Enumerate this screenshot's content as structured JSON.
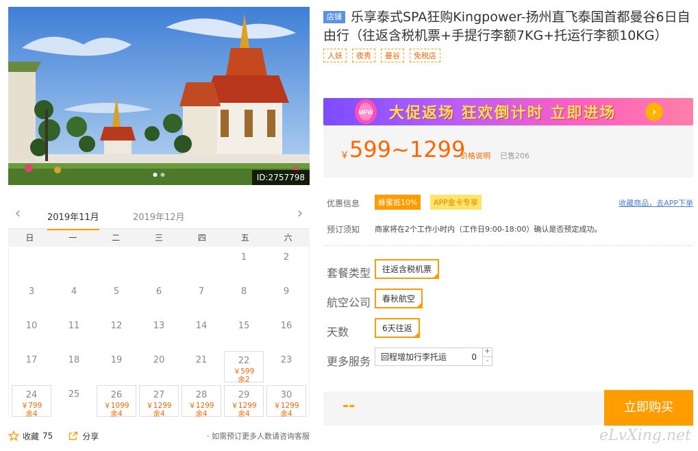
{
  "hero": {
    "image_id": "ID:2757798",
    "dots": 2,
    "active_dot": 0
  },
  "calendar": {
    "month_active": "2019年11月",
    "month_next": "2019年12月",
    "weekdays": [
      "日",
      "一",
      "二",
      "三",
      "四",
      "五",
      "六"
    ],
    "days": [
      {
        "d": ""
      },
      {
        "d": ""
      },
      {
        "d": ""
      },
      {
        "d": ""
      },
      {
        "d": ""
      },
      {
        "d": "1"
      },
      {
        "d": "2"
      },
      {
        "d": "3"
      },
      {
        "d": "4"
      },
      {
        "d": "5"
      },
      {
        "d": "6"
      },
      {
        "d": "7"
      },
      {
        "d": "8"
      },
      {
        "d": "9"
      },
      {
        "d": "10"
      },
      {
        "d": "11"
      },
      {
        "d": "12"
      },
      {
        "d": "13"
      },
      {
        "d": "14"
      },
      {
        "d": "15"
      },
      {
        "d": "16"
      },
      {
        "d": "17"
      },
      {
        "d": "18"
      },
      {
        "d": "19"
      },
      {
        "d": "20"
      },
      {
        "d": "21"
      },
      {
        "d": "22",
        "price": "￥599",
        "rem": "余2"
      },
      {
        "d": "23"
      },
      {
        "d": "24",
        "price": "￥799",
        "rem": "余4"
      },
      {
        "d": "25"
      },
      {
        "d": "26",
        "price": "￥1099",
        "rem": "余4"
      },
      {
        "d": "27",
        "price": "￥1299",
        "rem": "余4"
      },
      {
        "d": "28",
        "price": "￥1299",
        "rem": "余4"
      },
      {
        "d": "29",
        "price": "￥1299",
        "rem": "余4"
      },
      {
        "d": "30",
        "price": "￥1299",
        "rem": "余4"
      }
    ],
    "fav_label": "收藏",
    "fav_count": "75",
    "share_label": "分享",
    "hint": "· 如需预订更多人数请咨询客服"
  },
  "product": {
    "store_tag": "店铺",
    "title": "乐享泰式SPA狂购Kingpower-扬州直飞泰国首都曼谷6日自由行（往返含税机票+手提行李额7KG+托运行李额10KG）",
    "keywords": [
      "人妖",
      "夜秀",
      "曼谷",
      "免税店"
    ],
    "banner_text": "大促返场 狂欢倒计时 立即进场",
    "banner_badge": "MFW",
    "banner_go": "›",
    "price_yen": "￥",
    "price": "599~1299",
    "price_explain": "价格说明",
    "sold": "已售206"
  },
  "info": {
    "promo_label": "优惠信息",
    "badge_1": "蜂蜜抵10%",
    "badge_2": "APP金卡专享",
    "app_link": "收藏商品，去APP下单",
    "notice_label": "预订须知",
    "notice": "商家将在2个工作小时内（工作日9:00-18:00）确认是否预定成功。",
    "package_label": "套餐类型",
    "package_value": "往返含税机票",
    "airline_label": "航空公司",
    "airline_value": "春秋航空",
    "days_label": "天数",
    "days_value": "6天往返",
    "more_label": "更多服务",
    "more_service": "回程增加行李托运",
    "more_qty": "0",
    "plus": "+",
    "minus": "-"
  },
  "buy": {
    "total": "--",
    "button": "立即购买"
  },
  "watermark": "eLvXing.net"
}
